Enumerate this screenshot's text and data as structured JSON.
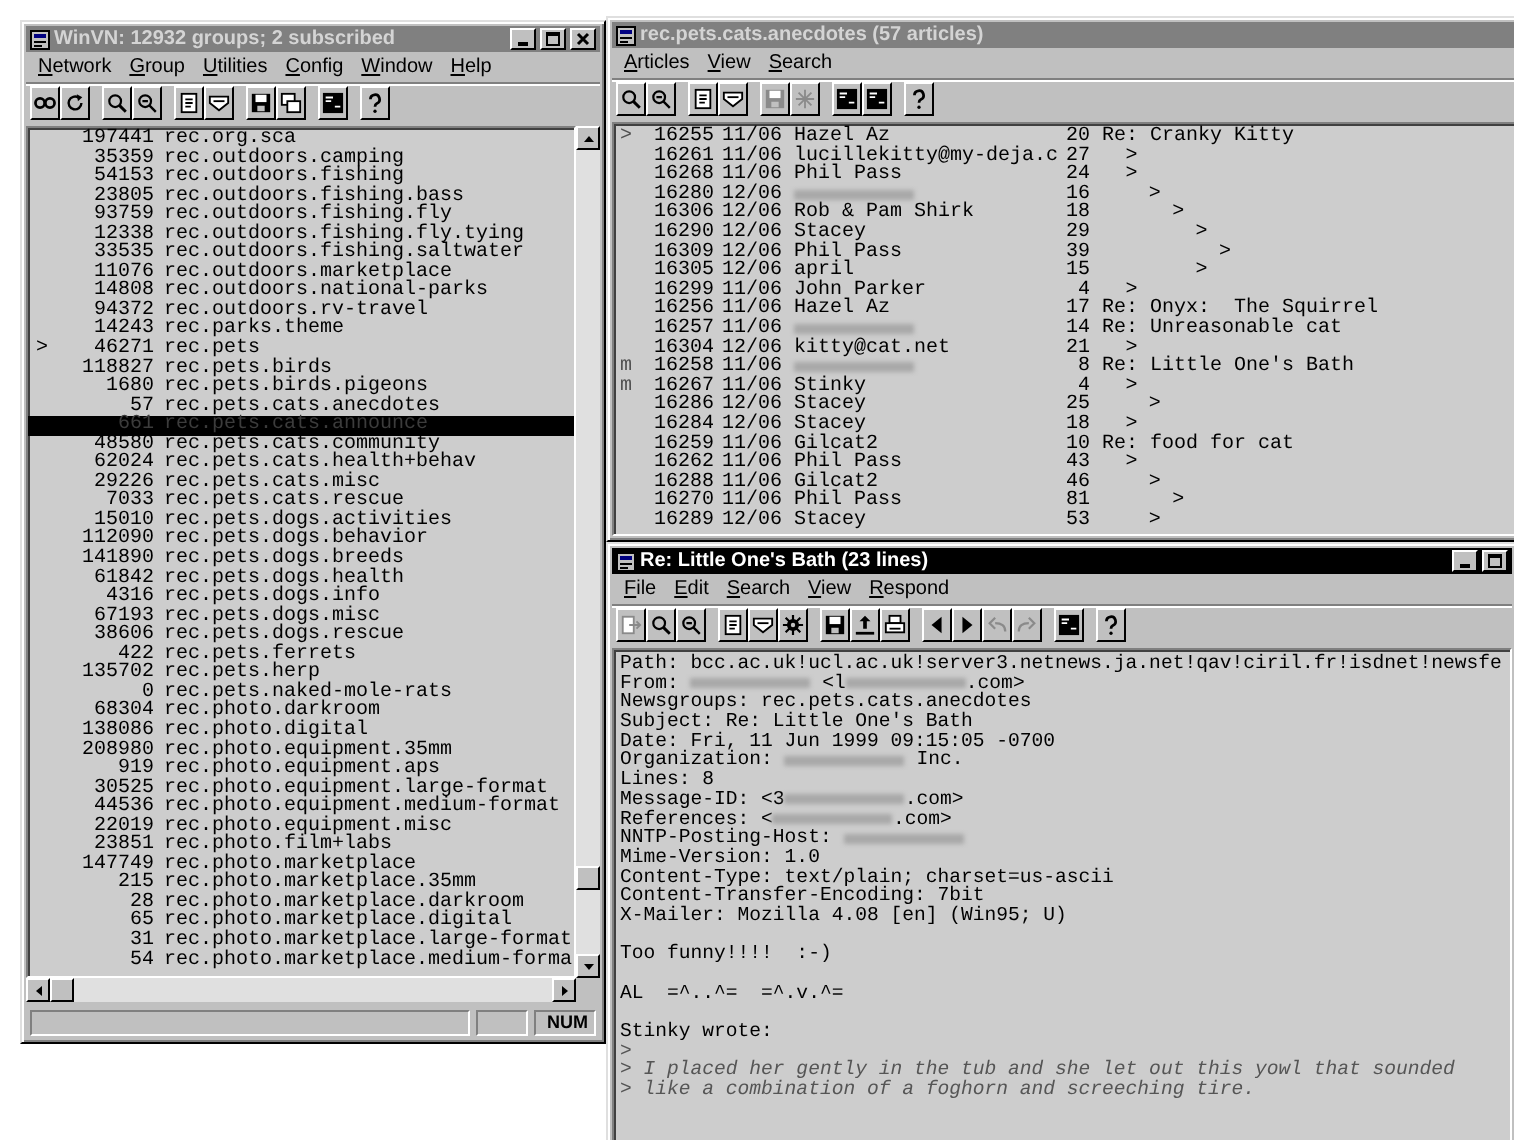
{
  "group_window": {
    "title": "WinVN: 12932 groups; 2 subscribed",
    "active": false,
    "title_buttons": [
      {
        "kind": "minimize"
      },
      {
        "kind": "maximize"
      },
      {
        "kind": "close"
      }
    ],
    "menu": [
      "Network",
      "Group",
      "Utilities",
      "Config",
      "Window",
      "Help"
    ],
    "toolbar": [
      [
        {
          "kind": "glasses",
          "disabled": false
        },
        {
          "kind": "refresh",
          "disabled": false
        }
      ],
      [
        {
          "kind": "search",
          "disabled": false
        },
        {
          "kind": "search_next",
          "disabled": false
        }
      ],
      [
        {
          "kind": "page",
          "disabled": false
        },
        {
          "kind": "tray",
          "disabled": false
        }
      ],
      [
        {
          "kind": "floppy",
          "disabled": false
        },
        {
          "kind": "windows",
          "disabled": false
        }
      ],
      [
        {
          "kind": "dark_panel",
          "disabled": false
        }
      ],
      [
        {
          "kind": "help",
          "disabled": false
        }
      ]
    ],
    "groups": [
      {
        "count": "197441",
        "name": "rec.org.sca",
        "selected": false
      },
      {
        "count": "35359",
        "name": "rec.outdoors.camping",
        "selected": false
      },
      {
        "count": "54153",
        "name": "rec.outdoors.fishing",
        "selected": false
      },
      {
        "count": "23805",
        "name": "rec.outdoors.fishing.bass",
        "selected": false
      },
      {
        "count": "93759",
        "name": "rec.outdoors.fishing.fly",
        "selected": false
      },
      {
        "count": "12338",
        "name": "rec.outdoors.fishing.fly.tying",
        "selected": false
      },
      {
        "count": "33535",
        "name": "rec.outdoors.fishing.saltwater",
        "selected": false
      },
      {
        "count": "11076",
        "name": "rec.outdoors.marketplace",
        "selected": false
      },
      {
        "count": "14808",
        "name": "rec.outdoors.national-parks",
        "selected": false
      },
      {
        "count": "94372",
        "name": "rec.outdoors.rv-travel",
        "selected": false
      },
      {
        "count": "14243",
        "name": "rec.parks.theme",
        "selected": false
      },
      {
        "flag": ">",
        "count": "46271",
        "name": "rec.pets",
        "selected": false
      },
      {
        "count": "118827",
        "name": "rec.pets.birds",
        "selected": false
      },
      {
        "count": "1680",
        "name": "rec.pets.birds.pigeons",
        "selected": false
      },
      {
        "count": "57",
        "name": "rec.pets.cats.anecdotes",
        "selected": false
      },
      {
        "count": "661",
        "name": "rec.pets.cats.announce",
        "selected": true
      },
      {
        "count": "48580",
        "name": "rec.pets.cats.community",
        "selected": false
      },
      {
        "count": "62024",
        "name": "rec.pets.cats.health+behav",
        "selected": false
      },
      {
        "count": "29226",
        "name": "rec.pets.cats.misc",
        "selected": false
      },
      {
        "count": "7033",
        "name": "rec.pets.cats.rescue",
        "selected": false
      },
      {
        "count": "15010",
        "name": "rec.pets.dogs.activities",
        "selected": false
      },
      {
        "count": "112090",
        "name": "rec.pets.dogs.behavior",
        "selected": false
      },
      {
        "count": "141890",
        "name": "rec.pets.dogs.breeds",
        "selected": false
      },
      {
        "count": "61842",
        "name": "rec.pets.dogs.health",
        "selected": false
      },
      {
        "count": "4316",
        "name": "rec.pets.dogs.info",
        "selected": false
      },
      {
        "count": "67193",
        "name": "rec.pets.dogs.misc",
        "selected": false
      },
      {
        "count": "38606",
        "name": "rec.pets.dogs.rescue",
        "selected": false
      },
      {
        "count": "422",
        "name": "rec.pets.ferrets",
        "selected": false
      },
      {
        "count": "135702",
        "name": "rec.pets.herp",
        "selected": false
      },
      {
        "count": "0",
        "name": "rec.pets.naked-mole-rats",
        "selected": false
      },
      {
        "count": "68304",
        "name": "rec.photo.darkroom",
        "selected": false
      },
      {
        "count": "138086",
        "name": "rec.photo.digital",
        "selected": false
      },
      {
        "count": "208980",
        "name": "rec.photo.equipment.35mm",
        "selected": false
      },
      {
        "count": "919",
        "name": "rec.photo.equipment.aps",
        "selected": false
      },
      {
        "count": "30525",
        "name": "rec.photo.equipment.large-format",
        "selected": false
      },
      {
        "count": "44536",
        "name": "rec.photo.equipment.medium-format",
        "selected": false
      },
      {
        "count": "22019",
        "name": "rec.photo.equipment.misc",
        "selected": false
      },
      {
        "count": "23851",
        "name": "rec.photo.film+labs",
        "selected": false
      },
      {
        "count": "147749",
        "name": "rec.photo.marketplace",
        "selected": false
      },
      {
        "count": "215",
        "name": "rec.photo.marketplace.35mm",
        "selected": false
      },
      {
        "count": "28",
        "name": "rec.photo.marketplace.darkroom",
        "selected": false
      },
      {
        "count": "65",
        "name": "rec.photo.marketplace.digital",
        "selected": false
      },
      {
        "count": "31",
        "name": "rec.photo.marketplace.large-format",
        "selected": false
      },
      {
        "count": "54",
        "name": "rec.photo.marketplace.medium-forma",
        "selected": false
      }
    ],
    "status_bar": {
      "indicator": "NUM"
    }
  },
  "article_list_window": {
    "title": "rec.pets.cats.anecdotes (57 articles)",
    "active": false,
    "menu": [
      "Articles",
      "View",
      "Search"
    ],
    "toolbar": [
      [
        {
          "kind": "search",
          "disabled": false
        },
        {
          "kind": "search_next",
          "disabled": false
        }
      ],
      [
        {
          "kind": "page",
          "disabled": false
        },
        {
          "kind": "tray",
          "disabled": false
        }
      ],
      [
        {
          "kind": "floppy",
          "disabled": true
        },
        {
          "kind": "sparkle",
          "disabled": true
        }
      ],
      [
        {
          "kind": "dark_panel",
          "disabled": false
        },
        {
          "kind": "dark_panel",
          "disabled": false
        }
      ],
      [
        {
          "kind": "help",
          "disabled": false
        }
      ]
    ],
    "articles": [
      {
        "flag": ">",
        "number": "16255",
        "date": "11/06",
        "author": "Hazel Az",
        "lines": "20",
        "subject": "Re: Cranky Kitty",
        "children": [
          {
            "number": "16261",
            "date": "11/06",
            "author": "lucillekitty@my-deja.c",
            "lines": "27",
            "subject": ">"
          },
          {
            "number": "16268",
            "date": "11/06",
            "author": "Phil Pass",
            "lines": "24",
            "subject": ">",
            "children": [
              {
                "number": "16280",
                "date": "12/06",
                "lines": "16",
                "subject": ">",
                "children": [
                  {
                    "number": "16306",
                    "date": "12/06",
                    "author": "Rob & Pam Shirk",
                    "lines": "18",
                    "subject": ">",
                    "children": [
                      {
                        "number": "16290",
                        "date": "12/06",
                        "author": "Stacey",
                        "lines": "29",
                        "subject": ">",
                        "children": [
                          {
                            "number": "16309",
                            "date": "12/06",
                            "author": "Phil Pass",
                            "lines": "39",
                            "subject": ">"
                          }
                        ]
                      },
                      {
                        "number": "16305",
                        "date": "12/06",
                        "author": "april",
                        "lines": "15",
                        "subject": ">"
                      }
                    ]
                  }
                ]
              }
            ]
          },
          {
            "number": "16299",
            "date": "11/06",
            "author": "John Parker",
            "lines": "4",
            "subject": ">"
          }
        ]
      },
      {
        "number": "16256",
        "date": "11/06",
        "author": "Hazel Az",
        "lines": "17",
        "subject": "Re: Onyx:  The Squirrel"
      },
      {
        "number": "16257",
        "date": "11/06",
        "lines": "14",
        "subject": "Re: Unreasonable cat",
        "children": [
          {
            "number": "16304",
            "date": "12/06",
            "author": "kitty@cat.net",
            "lines": "21",
            "subject": ">"
          }
        ]
      },
      {
        "flag": "m",
        "number": "16258",
        "date": "11/06",
        "lines": "8",
        "subject": "Re: Little One's Bath",
        "children": [
          {
            "flag": "m",
            "number": "16267",
            "date": "11/06",
            "author": "Stinky",
            "lines": "4",
            "subject": ">",
            "children": [
              {
                "number": "16286",
                "date": "12/06",
                "author": "Stacey",
                "lines": "25",
                "subject": ">"
              }
            ]
          },
          {
            "number": "16284",
            "date": "12/06",
            "author": "Stacey",
            "lines": "18",
            "subject": ">"
          }
        ]
      },
      {
        "number": "16259",
        "date": "11/06",
        "author": "Gilcat2",
        "lines": "10",
        "subject": "Re: food for cat",
        "children": [
          {
            "number": "16262",
            "date": "11/06",
            "author": "Phil Pass",
            "lines": "43",
            "subject": ">",
            "children": [
              {
                "number": "16288",
                "date": "11/06",
                "author": "Gilcat2",
                "lines": "46",
                "subject": ">",
                "children": [
                  {
                    "number": "16270",
                    "date": "11/06",
                    "author": "Phil Pass",
                    "lines": "81",
                    "subject": ">"
                  }
                ]
              },
              {
                "number": "16289",
                "date": "12/06",
                "author": "Stacey",
                "lines": "53",
                "subject": ">"
              }
            ]
          }
        ]
      }
    ]
  },
  "article_window": {
    "title": "Re: Little One's Bath (23 lines)",
    "active": true,
    "title_buttons": [
      {
        "kind": "minimize"
      },
      {
        "kind": "maximize"
      }
    ],
    "menu": [
      "File",
      "Edit",
      "Search",
      "View",
      "Respond"
    ],
    "toolbar": [
      [
        {
          "kind": "exit",
          "disabled": true
        },
        {
          "kind": "search",
          "disabled": false
        },
        {
          "kind": "search_next",
          "disabled": false
        }
      ],
      [
        {
          "kind": "page",
          "disabled": false
        },
        {
          "kind": "tray",
          "disabled": false
        },
        {
          "kind": "gear",
          "disabled": false
        }
      ],
      [
        {
          "kind": "floppy",
          "disabled": false
        },
        {
          "kind": "upload",
          "disabled": false
        },
        {
          "kind": "printer",
          "disabled": false
        }
      ],
      [
        {
          "kind": "arrow_left",
          "disabled": false
        },
        {
          "kind": "arrow_right",
          "disabled": false
        },
        {
          "kind": "reply",
          "disabled": true
        },
        {
          "kind": "forward",
          "disabled": true
        }
      ],
      [
        {
          "kind": "dark_panel",
          "disabled": false
        }
      ],
      [
        {
          "kind": "help",
          "disabled": false
        }
      ]
    ],
    "lines": [
      {
        "kind": "text",
        "text": "Path: bcc.ac.uk!ucl.ac.uk!server3.netnews.ja.net!qav!ciril.fr!isdnet!newsfe"
      },
      {
        "kind": "mixed",
        "segments": [
          {
            "kind": "text",
            "text": "From: "
          },
          {
            "kind": "redacted"
          },
          {
            "kind": "text",
            "text": " <l"
          },
          {
            "kind": "redacted"
          },
          {
            "kind": "text",
            "text": ".com>"
          }
        ]
      },
      {
        "kind": "text",
        "text": "Newsgroups: rec.pets.cats.anecdotes"
      },
      {
        "kind": "text",
        "text": "Subject: Re: Little One's Bath"
      },
      {
        "kind": "text",
        "text": "Date: Fri, 11 Jun 1999 09:15:05 -0700"
      },
      {
        "kind": "mixed",
        "segments": [
          {
            "kind": "text",
            "text": "Organization: "
          },
          {
            "kind": "redacted"
          },
          {
            "kind": "text",
            "text": " Inc."
          }
        ]
      },
      {
        "kind": "text",
        "text": "Lines: 8"
      },
      {
        "kind": "mixed",
        "segments": [
          {
            "kind": "text",
            "text": "Message-ID: <3"
          },
          {
            "kind": "redacted"
          },
          {
            "kind": "text",
            "text": ".com>"
          }
        ]
      },
      {
        "kind": "mixed",
        "segments": [
          {
            "kind": "text",
            "text": "References: <"
          },
          {
            "kind": "redacted"
          },
          {
            "kind": "text",
            "text": ".com>"
          }
        ]
      },
      {
        "kind": "mixed",
        "segments": [
          {
            "kind": "text",
            "text": "NNTP-Posting-Host: "
          },
          {
            "kind": "redacted"
          }
        ]
      },
      {
        "kind": "text",
        "text": "Mime-Version: 1.0"
      },
      {
        "kind": "text",
        "text": "Content-Type: text/plain; charset=us-ascii"
      },
      {
        "kind": "text",
        "text": "Content-Transfer-Encoding: 7bit"
      },
      {
        "kind": "text",
        "text": "X-Mailer: Mozilla 4.08 [en] (Win95; U)"
      },
      {
        "kind": "blank"
      },
      {
        "kind": "text",
        "text": "Too funny!!!!  :-)"
      },
      {
        "kind": "blank"
      },
      {
        "kind": "text",
        "text": "AL  =^..^=  =^.v.^="
      },
      {
        "kind": "blank"
      },
      {
        "kind": "text",
        "text": "Stinky wrote:"
      },
      {
        "kind": "quote",
        "text": ">"
      },
      {
        "kind": "quote",
        "text": "> I placed her gently in the tub and she let out this yowl that sounded"
      },
      {
        "kind": "quote",
        "text": "> like a combination of a foghorn and screeching tire."
      }
    ]
  }
}
